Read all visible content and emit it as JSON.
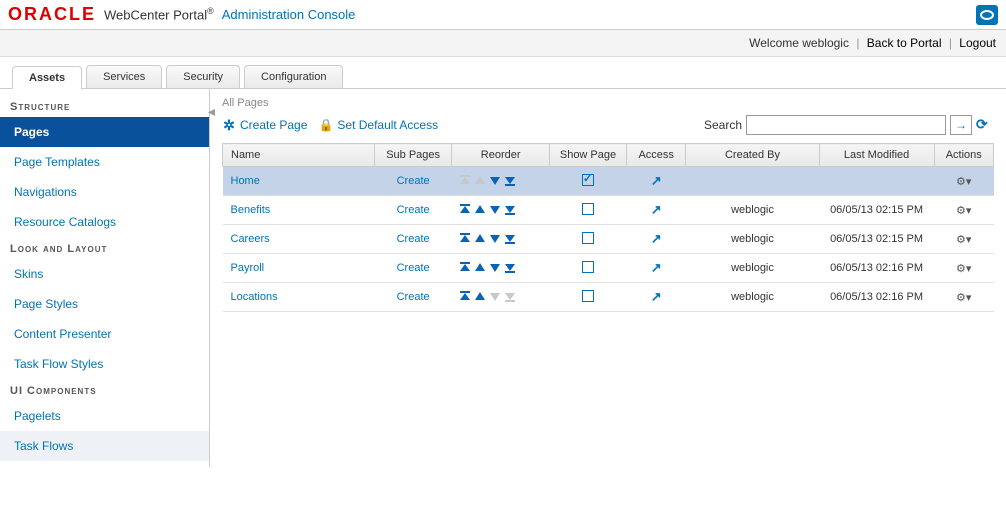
{
  "header": {
    "logo": "ORACLE",
    "product": "WebCenter Portal",
    "console": "Administration Console"
  },
  "welcome": {
    "text": "Welcome weblogic",
    "back": "Back to Portal",
    "logout": "Logout"
  },
  "tabs": [
    {
      "label": "Assets",
      "active": true
    },
    {
      "label": "Services",
      "active": false
    },
    {
      "label": "Security",
      "active": false
    },
    {
      "label": "Configuration",
      "active": false
    }
  ],
  "sidebar": {
    "sections": [
      {
        "heading": "Structure",
        "items": [
          {
            "label": "Pages",
            "active": true
          },
          {
            "label": "Page Templates"
          },
          {
            "label": "Navigations"
          },
          {
            "label": "Resource Catalogs"
          }
        ]
      },
      {
        "heading": "Look and Layout",
        "items": [
          {
            "label": "Skins"
          },
          {
            "label": "Page Styles"
          },
          {
            "label": "Content Presenter"
          },
          {
            "label": "Task Flow Styles"
          }
        ]
      },
      {
        "heading": "UI Components",
        "items": [
          {
            "label": "Pagelets"
          },
          {
            "label": "Task Flows",
            "highlight": true
          }
        ]
      }
    ]
  },
  "content": {
    "breadcrumb": "All Pages",
    "createPage": "Create Page",
    "setDefault": "Set Default Access",
    "searchLabel": "Search",
    "columns": [
      "Name",
      "Sub Pages",
      "Reorder",
      "Show Page",
      "Access",
      "Created By",
      "Last Modified",
      "Actions"
    ],
    "rows": [
      {
        "name": "Home",
        "sub": "Create",
        "show": true,
        "createdBy": "",
        "modified": "",
        "selected": true,
        "first": true,
        "last": false
      },
      {
        "name": "Benefits",
        "sub": "Create",
        "show": false,
        "createdBy": "weblogic",
        "modified": "06/05/13 02:15 PM",
        "first": false,
        "last": false
      },
      {
        "name": "Careers",
        "sub": "Create",
        "show": false,
        "createdBy": "weblogic",
        "modified": "06/05/13 02:15 PM",
        "first": false,
        "last": false
      },
      {
        "name": "Payroll",
        "sub": "Create",
        "show": false,
        "createdBy": "weblogic",
        "modified": "06/05/13 02:16 PM",
        "first": false,
        "last": false
      },
      {
        "name": "Locations",
        "sub": "Create",
        "show": false,
        "createdBy": "weblogic",
        "modified": "06/05/13 02:16 PM",
        "first": false,
        "last": true
      }
    ]
  }
}
